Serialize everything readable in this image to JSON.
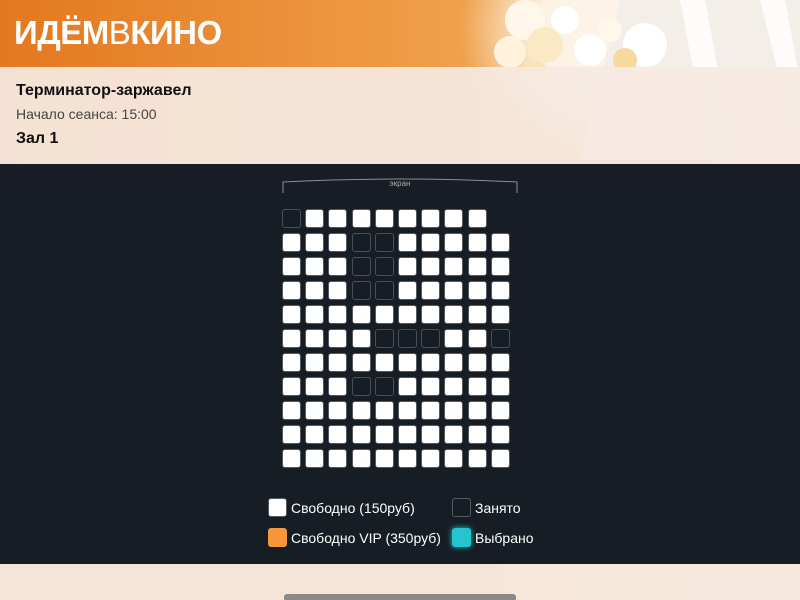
{
  "header": {
    "logo_part1": "ИДЁМ",
    "logo_part2": "В",
    "logo_part3": "КИНО"
  },
  "movie": {
    "title": "Терминатор-заржавел",
    "session_time": "Начало сеанса: 15:00",
    "hall": "Зал 1"
  },
  "screen_label": "экран",
  "seat_map": [
    "xffffffff",
    "fffxxfffff",
    "fffxxfffff",
    "fffxxfffff",
    "ffffffffff",
    "ffffxxxffx",
    "ffffffffff",
    "fffxxfffff",
    "ffffffffff",
    "ffffffffff",
    "ffffffffff"
  ],
  "legend": {
    "free": "Свободно (150руб)",
    "taken": "Занято",
    "vip": "Свободно VIP (350руб)",
    "selected": "Выбрано"
  },
  "colors": {
    "free": "#ffffff",
    "taken": "#171d24",
    "vip": "#f5973a",
    "selected": "#25c4ce",
    "background": "#171d24"
  }
}
